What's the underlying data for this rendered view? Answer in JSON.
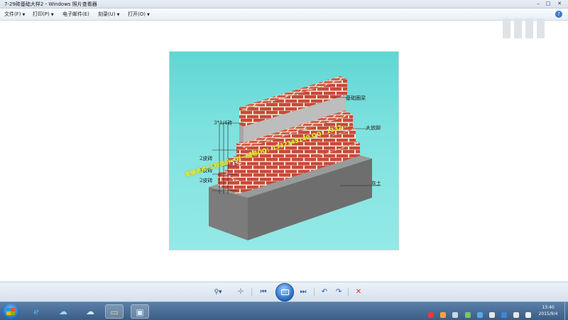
{
  "window": {
    "title": "7-29砖基础大样2 - Windows 照片查看器",
    "controls": {
      "minimize": "–",
      "maximize": "□",
      "close": "✕"
    }
  },
  "menu": {
    "items": [
      {
        "label": "文件(F)"
      },
      {
        "label": "打印(P)"
      },
      {
        "label": "电子邮件(E)"
      },
      {
        "label": "刻录(U)"
      },
      {
        "label": "打开(O)"
      }
    ],
    "help_icon": "help-icon"
  },
  "image": {
    "labels": {
      "foundation_beam": "基础圈梁",
      "size_label": "3*1/4砖",
      "course_top": "2皮砖",
      "course_mid": "1皮砖",
      "course_bottom": "2皮砖",
      "damp_layer": "大放脚",
      "soil": "灰土"
    },
    "watermark": "黄蜂老师 工程造价一对一辅导QQ：1332345140  QQ：1332..."
  },
  "nav": {
    "zoom": "⚲▾",
    "fit": "✢",
    "prev": "⏮",
    "next": "⏭",
    "rotate_left": "↶",
    "rotate_right": "↷",
    "delete": "✕"
  },
  "taskbar": {
    "clock_time": "13:40",
    "clock_date": "2015/9/4"
  },
  "colors": {
    "brick": "#c8493a",
    "mortar": "#f3e9dd",
    "concrete": "#8c8c8c",
    "background": "#6fdcd9"
  }
}
